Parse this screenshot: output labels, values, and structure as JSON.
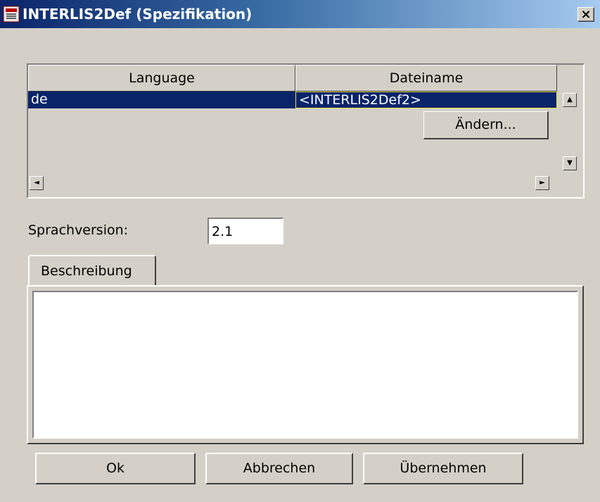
{
  "window": {
    "title": "INTERLIS2Def (Spezifikation)",
    "icon": "app-icon",
    "close_label": "×"
  },
  "table": {
    "columns": [
      "Language",
      "Dateiname"
    ],
    "rows": [
      {
        "language": "de",
        "dateiname": "<INTERLIS2Def2>"
      }
    ],
    "selected_row": 0
  },
  "context_button": {
    "label": "Ändern..."
  },
  "sprachversion": {
    "label": "Sprachversion:",
    "value": "2.1"
  },
  "tabs": [
    {
      "label": "Beschreibung",
      "active": true
    }
  ],
  "beschreibung": {
    "value": ""
  },
  "buttons": {
    "ok": "Ok",
    "cancel": "Abbrechen",
    "apply": "Übernehmen"
  },
  "scroll_icons": {
    "up": "▲",
    "down": "▼",
    "left": "◄",
    "right": "►"
  },
  "colors": {
    "selection": "#0a246a",
    "dialog_bg": "#d4d0c8",
    "focus_border": "#e8e040"
  }
}
